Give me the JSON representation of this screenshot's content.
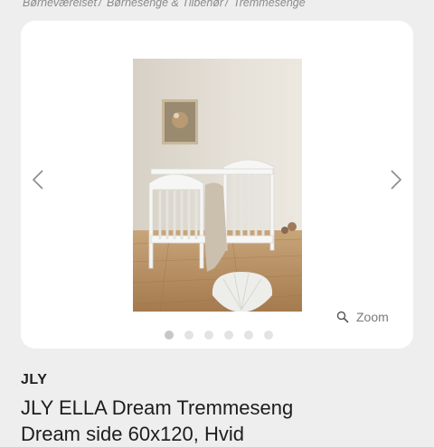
{
  "breadcrumb": {
    "items": [
      "Børneværelset",
      "Børnesenge & Tilbehør",
      "Tremmesenge"
    ],
    "separator": "/"
  },
  "gallery": {
    "image_alt": "Hvid tremmeseng i børneværelse",
    "zoom_label": "Zoom",
    "dot_count": 6,
    "active_index": 0,
    "prev_icon": "chevron-left-icon",
    "next_icon": "chevron-right-icon"
  },
  "product": {
    "brand": "JLY",
    "title_line1": "JLY ELLA Dream Tremmeseng",
    "title_line2": "Dream side 60x120, Hvid"
  },
  "colors": {
    "background": "#eeeeee",
    "card": "#ffffff",
    "text": "#1d1d1d",
    "muted": "#8a8a8a"
  }
}
